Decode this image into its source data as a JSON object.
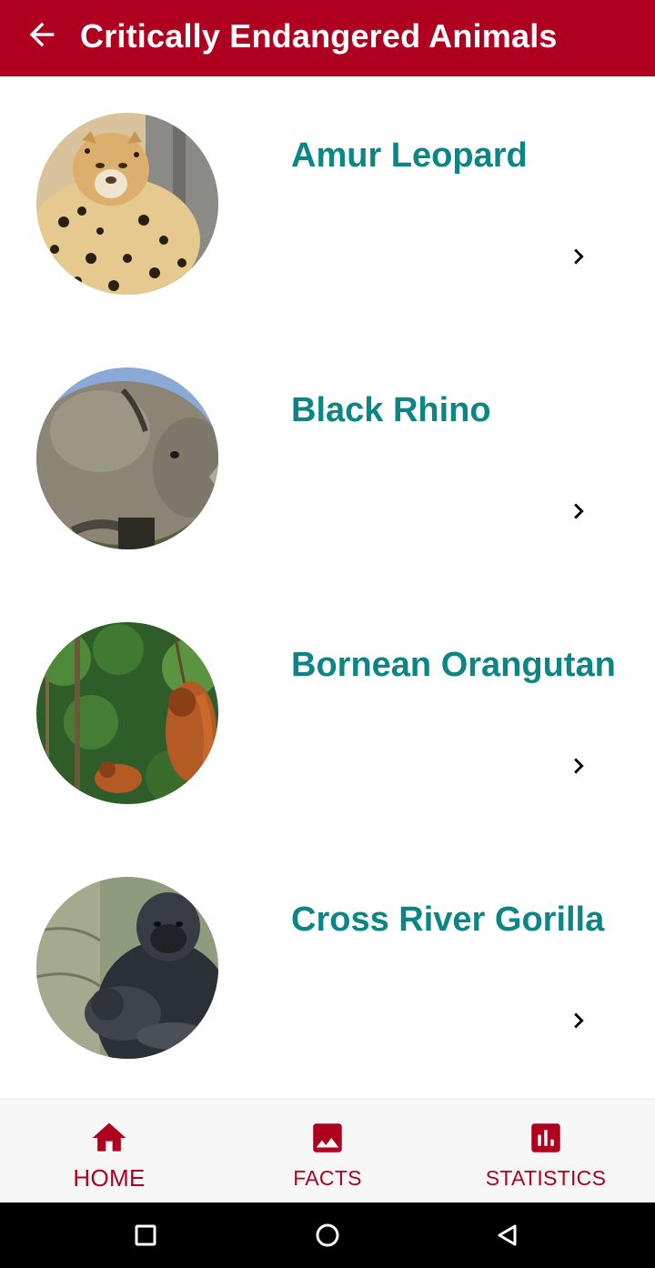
{
  "app_bar": {
    "title": "Critically Endangered Animals",
    "back_icon": "arrow-back-icon",
    "background": "#b00020"
  },
  "animals": [
    {
      "name": "Amur Leopard",
      "image": "amur-leopard-photo"
    },
    {
      "name": "Black Rhino",
      "image": "black-rhino-photo"
    },
    {
      "name": "Bornean Orangutan",
      "image": "bornean-orangutan-photo"
    },
    {
      "name": "Cross River Gorilla",
      "image": "cross-river-gorilla-photo"
    }
  ],
  "bottom_nav": {
    "items": [
      {
        "label": "HOME",
        "icon": "home-icon",
        "active": true
      },
      {
        "label": "FACTS",
        "icon": "image-icon",
        "active": false
      },
      {
        "label": "STATISTICS",
        "icon": "bar-chart-icon",
        "active": false
      }
    ]
  },
  "colors": {
    "accent": "#b00020",
    "animal_name": "#0b8684",
    "nav_background": "#f7f7f7"
  }
}
